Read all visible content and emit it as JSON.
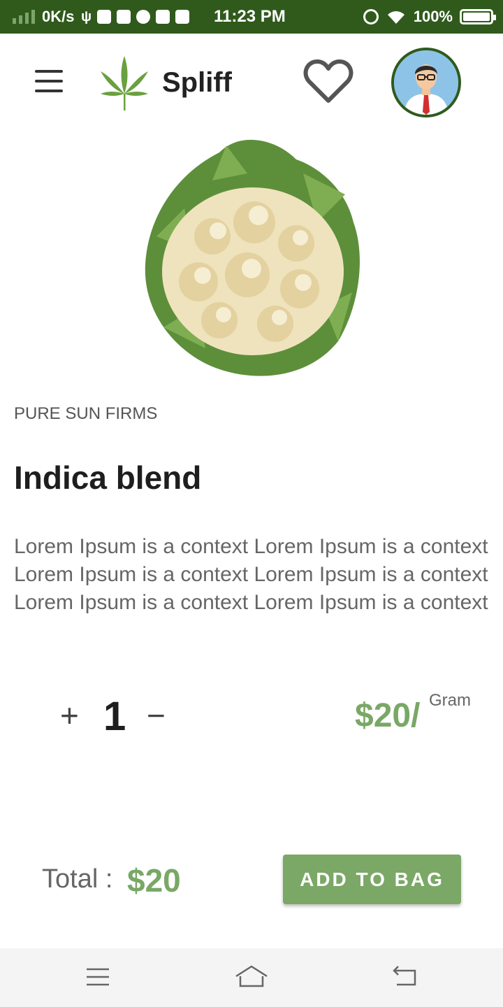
{
  "status_bar": {
    "net_speed": "0K/s",
    "time": "11:23 PM",
    "battery": "100%",
    "icons": [
      "signal-icon",
      "usb-icon",
      "sim-icon",
      "mail-icon",
      "messenger-icon",
      "clipboard-icon",
      "shield-icon",
      "alarm-icon",
      "wifi-icon",
      "battery-icon"
    ]
  },
  "header": {
    "brand": "Spliff",
    "menu_icon": "hamburger-menu-icon",
    "logo_icon": "cannabis-leaf-icon",
    "favorite_icon": "heart-icon",
    "avatar_icon": "user-avatar-icon"
  },
  "product": {
    "vendor": "PURE SUN FIRMS",
    "name": "Indica blend",
    "description": "Lorem Ipsum is a context Lorem Ipsum is a context Lorem Ipsum is a context Lorem Ipsum is a context Lorem Ipsum is a context Lorem Ipsum is a context",
    "image_icon": "cauliflower-image"
  },
  "quantity": {
    "plus": "+",
    "value": "1",
    "minus": "−"
  },
  "price": {
    "amount": "$20/",
    "unit": "Gram"
  },
  "total": {
    "label": "Total : ",
    "value": "$20"
  },
  "add_to_bag": "ADD TO BAG",
  "nav": {
    "menu_icon": "nav-menu-icon",
    "home_icon": "nav-home-icon",
    "back_icon": "nav-back-icon"
  },
  "colors": {
    "status_bar": "#2f5a1c",
    "accent_green": "#7ba866",
    "text_dark": "#1e1e1e",
    "text_gray": "#666666"
  }
}
